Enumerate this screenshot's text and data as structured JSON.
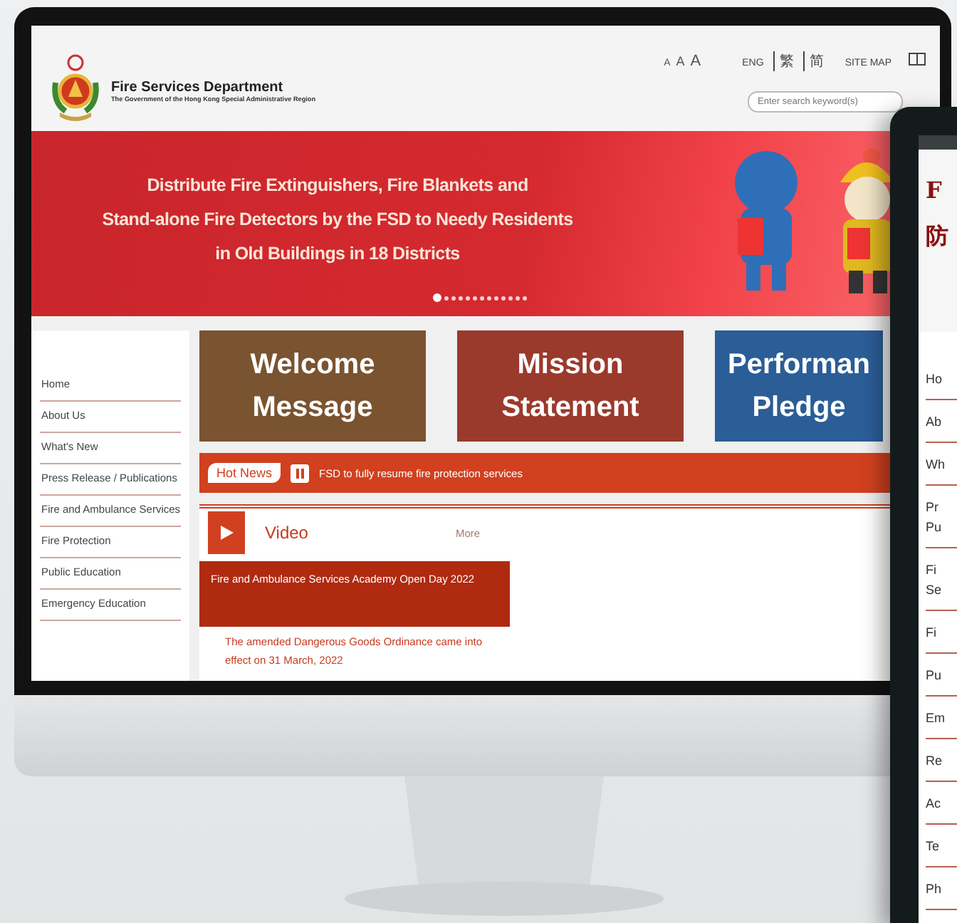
{
  "site_header": {
    "title": "Fire Services Department",
    "subtitle": "The Government of the Hong Kong Special Administrative Region",
    "font_sizes": [
      "A",
      "A",
      "A"
    ],
    "languages": [
      "ENG",
      "繁",
      "简"
    ],
    "site_map": "SITE MAP",
    "search": {
      "placeholder": "Enter search keyword(s)"
    }
  },
  "banner": {
    "lines": [
      "Distribute Fire Extinguishers, Fire Blankets and",
      "Stand-alone Fire Detectors by the FSD to Needy Residents",
      "in Old Buildings in 18 Districts"
    ],
    "dots": [
      {
        "selected": true
      },
      {
        "selected": false
      },
      {
        "selected": false
      },
      {
        "selected": false
      },
      {
        "selected": false
      },
      {
        "selected": false
      },
      {
        "selected": false
      },
      {
        "selected": false
      },
      {
        "selected": false
      },
      {
        "selected": false
      },
      {
        "selected": false
      },
      {
        "selected": false
      },
      {
        "selected": false
      }
    ]
  },
  "sidebar": {
    "items": [
      "Home",
      "About Us",
      "What's New",
      "Press Release / Publications",
      "Fire and Ambulance Services",
      "Fire Protection",
      "Public Education",
      "Emergency Education"
    ]
  },
  "tiles": [
    {
      "lines": [
        "Welcome",
        "Message"
      ],
      "color": "#7a5330"
    },
    {
      "lines": [
        "Mission",
        "Statement"
      ],
      "color": "#9a3a2c"
    },
    {
      "lines": [
        "Performan",
        "Pledge"
      ],
      "color": "#2b5d97"
    }
  ],
  "hot_news": {
    "label": "Hot News",
    "text": "FSD to fully resume fire protection services"
  },
  "video": {
    "title": "Video",
    "more": "More",
    "featured": "Fire and Ambulance Services Academy Open Day 2022",
    "next": "The amended Dangerous Goods Ordinance came into effect on 31 March, 2022"
  },
  "tablet": {
    "heading": [
      "F",
      "防"
    ],
    "items": [
      "Ho",
      "Ab",
      "Wh",
      "Pr\nPu",
      "Fi\nSe",
      "Fi",
      "Pu",
      "Em",
      "Re",
      "Ac",
      "Te",
      "Ph"
    ]
  }
}
